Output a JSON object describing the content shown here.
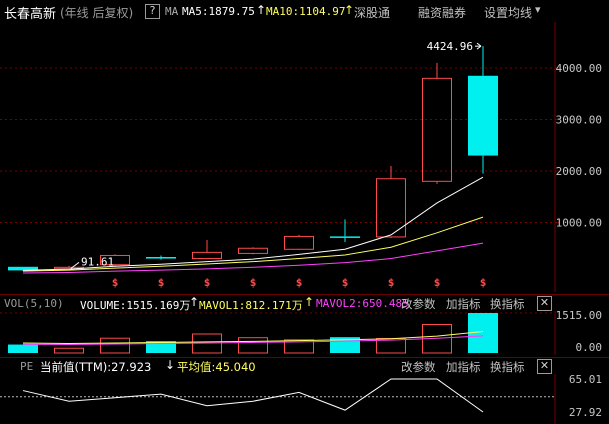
{
  "header": {
    "stock_name": "长春高新",
    "period_label": "(年线 后复权)",
    "question_glyph": "?",
    "ma_label": "MA",
    "ma5": "MA5:1879.75",
    "ma5_arrow": "↑",
    "ma10": "MA10:1104.97",
    "ma10_arrow": "↑",
    "shenzhen_connect": "深股通",
    "margin_trading": "融资融券",
    "settings_label": "设置均线",
    "settings_arrow": "▾"
  },
  "main_chart": {
    "y_ticks": [
      "4000.00",
      "3000.00",
      "2000.00",
      "1000.00"
    ],
    "high_label": "4424.96",
    "low_label": "91.61",
    "marker_glyph": "$",
    "colors": {
      "up": "#ff4a4a",
      "down": "#00f0f0",
      "ma5": "#ffffff",
      "ma10": "#ffff60",
      "ma20": "#ff40ff"
    }
  },
  "vol_panel": {
    "title": "VOL(5,10)",
    "volume": "VOLUME:1515.169万",
    "volume_arrow": "↑",
    "mavol1": "MAVOL1:812.171万",
    "mavol1_arrow": "↑",
    "mavol2": "MAVOL2:650.485",
    "change_params": "改参数",
    "add_indicator": "加指标",
    "switch_indicator": "换指标",
    "close_glyph": "✕",
    "y_ticks": [
      "1515.00",
      "0.00"
    ]
  },
  "pe_panel": {
    "title": "PE",
    "current_value": "当前值(TTM):27.923",
    "current_arrow": "↓",
    "average_value": "平均值:45.040",
    "change_params": "改参数",
    "add_indicator": "加指标",
    "switch_indicator": "换指标",
    "close_glyph": "✕",
    "y_ticks": [
      "65.01",
      "27.92"
    ]
  },
  "chart_data": {
    "type": "candlestick",
    "price": {
      "candles": [
        {
          "open": 140,
          "close": 70,
          "high": 140,
          "low": 60,
          "direction": "down"
        },
        {
          "open": 110,
          "close": 130,
          "high": 160,
          "low": 90,
          "direction": "up"
        },
        {
          "open": 180,
          "close": 360,
          "high": 380,
          "low": 140,
          "direction": "up"
        },
        {
          "open": 330,
          "close": 300,
          "high": 360,
          "low": 280,
          "direction": "down"
        },
        {
          "open": 300,
          "close": 420,
          "high": 660,
          "low": 290,
          "direction": "up"
        },
        {
          "open": 400,
          "close": 500,
          "high": 520,
          "low": 380,
          "direction": "up"
        },
        {
          "open": 480,
          "close": 730,
          "high": 760,
          "low": 470,
          "direction": "up"
        },
        {
          "open": 730,
          "close": 710,
          "high": 1060,
          "low": 620,
          "direction": "down"
        },
        {
          "open": 720,
          "close": 1850,
          "high": 2100,
          "low": 700,
          "direction": "up"
        },
        {
          "open": 1800,
          "close": 3800,
          "high": 4100,
          "low": 1750,
          "direction": "up"
        },
        {
          "open": 3850,
          "close": 2300,
          "high": 4424.96,
          "low": 1950,
          "direction": "down"
        }
      ],
      "ma5": [
        70,
        95,
        150,
        190,
        240,
        290,
        380,
        480,
        760,
        1380,
        1879.75
      ],
      "ma10": [
        55,
        75,
        115,
        150,
        195,
        240,
        300,
        370,
        520,
        800,
        1104.97
      ],
      "ma20": [
        20,
        30,
        55,
        75,
        100,
        130,
        170,
        220,
        300,
        450,
        600
      ],
      "ylim": [
        0,
        4700
      ]
    },
    "volume": {
      "values": [
        320,
        180,
        560,
        450,
        720,
        580,
        500,
        600,
        550,
        1080,
        1515.169
      ],
      "directions": [
        "down",
        "up",
        "up",
        "down",
        "up",
        "up",
        "up",
        "down",
        "up",
        "up",
        "down"
      ],
      "mavol1": [
        380,
        360,
        380,
        400,
        420,
        440,
        470,
        500,
        540,
        640,
        812.171
      ],
      "mavol2": [
        330,
        320,
        340,
        360,
        380,
        400,
        420,
        450,
        490,
        560,
        650.485
      ],
      "ylim": [
        0,
        1515
      ]
    },
    "pe": {
      "values": [
        52,
        40,
        44,
        48,
        35,
        40,
        50,
        30,
        65.01,
        65.01,
        27.923
      ],
      "average": 45.04,
      "ylim": [
        27.92,
        65.01
      ]
    }
  }
}
